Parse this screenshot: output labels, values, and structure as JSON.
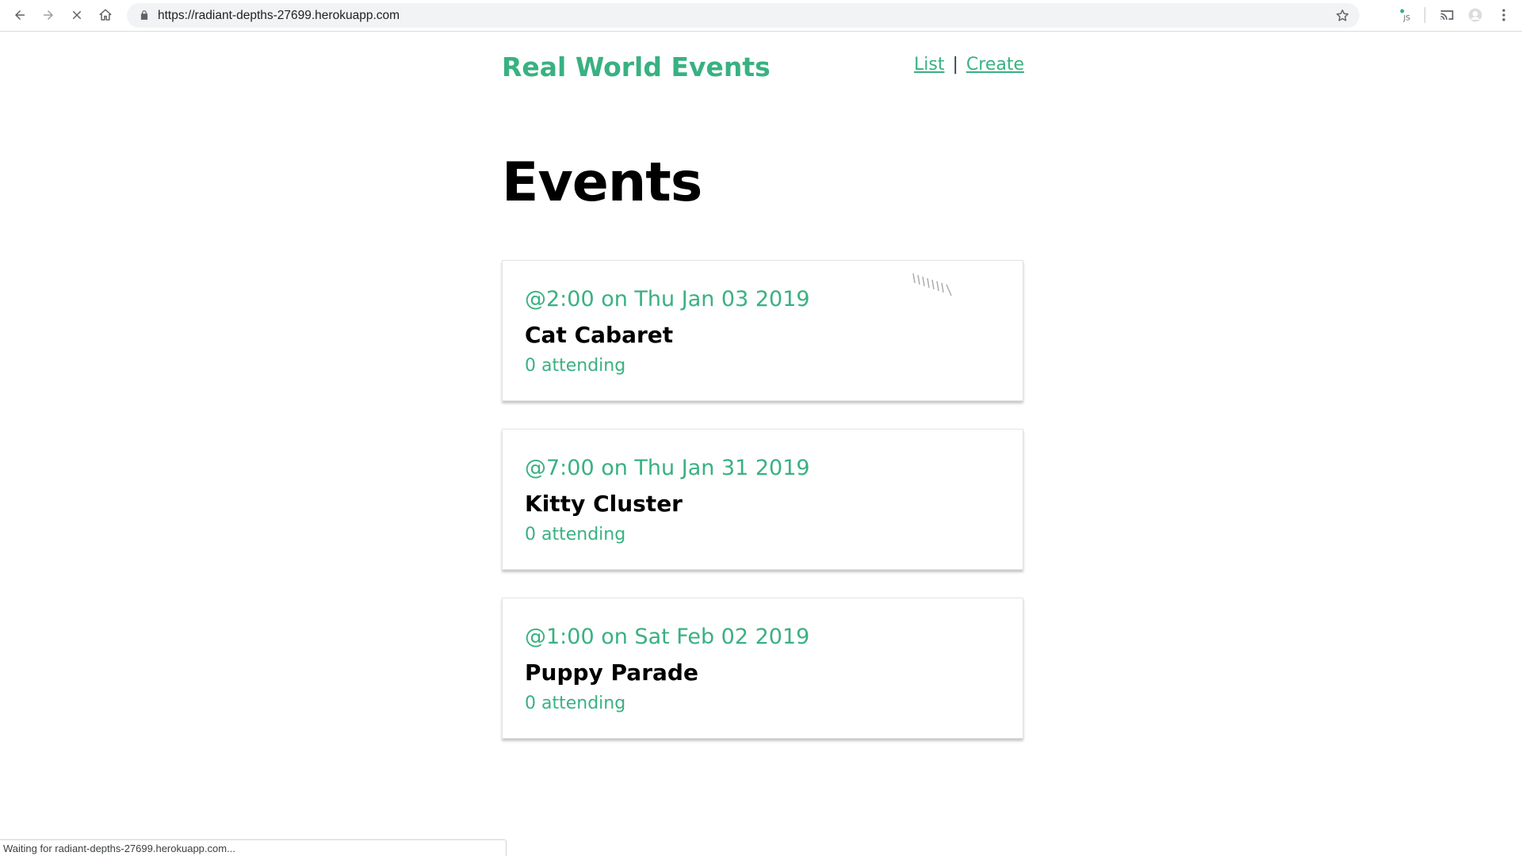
{
  "browser": {
    "url": "https://radiant-depths-27699.herokuapp.com",
    "icons": {
      "back": "arrow-left-icon",
      "forward": "arrow-right-icon",
      "stop": "close-icon",
      "home": "home-icon",
      "lock": "lock-icon",
      "bookmark": "star-icon",
      "extension": "vue-devtools-extension-icon",
      "cast": "cast-icon",
      "profile": "profile-avatar-icon",
      "menu": "more-vertical-icon"
    }
  },
  "header": {
    "brand": "Real World Events",
    "nav": {
      "list": "List",
      "separator": "|",
      "create": "Create"
    }
  },
  "main": {
    "title": "Events",
    "events": [
      {
        "when": "@2:00 on Thu Jan 03 2019",
        "title": "Cat Cabaret",
        "attending": "0 attending"
      },
      {
        "when": "@7:00 on Thu Jan 31 2019",
        "title": "Kitty Cluster",
        "attending": "0 attending"
      },
      {
        "when": "@1:00 on Sat Feb 02 2019",
        "title": "Puppy Parade",
        "attending": "0 attending"
      }
    ]
  },
  "status": {
    "text": "Waiting for radiant-depths-27699.herokuapp.com..."
  },
  "colors": {
    "accent": "#39b182",
    "text": "#000000",
    "navText": "#2c3e50"
  }
}
